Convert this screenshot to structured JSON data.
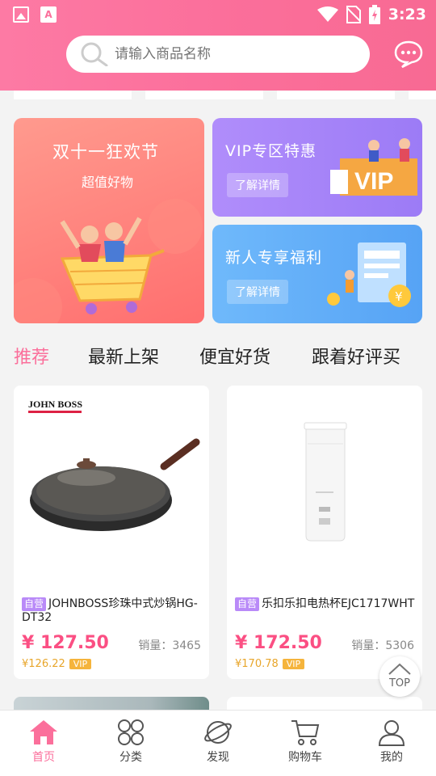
{
  "status_bar": {
    "time": "3:23"
  },
  "search": {
    "placeholder": "请输入商品名称"
  },
  "banners": {
    "main": {
      "title": "双十一狂欢节",
      "subtitle": "超值好物"
    },
    "vip": {
      "title": "VIP专区特惠",
      "button": "了解详情",
      "badge": "VIP"
    },
    "new": {
      "title": "新人专享福利",
      "button": "了解详情"
    }
  },
  "tabs": [
    "推荐",
    "最新上架",
    "便宜好货",
    "跟着好评买"
  ],
  "products": [
    {
      "brand": "JOHN BOSS",
      "tag": "自营",
      "name": "JOHNBOSS珍珠中式炒锅HG-DT32",
      "price": "¥ 127.50",
      "sales": "销量：3465",
      "vip_price": "¥126.22",
      "vip_tag": "VIP"
    },
    {
      "brand": "",
      "tag": "自营",
      "name": "乐扣乐扣电热杯EJC1717WHT",
      "price": "¥ 172.50",
      "sales": "销量：5306",
      "vip_price": "¥170.78",
      "vip_tag": "VIP"
    }
  ],
  "top_button": "TOP",
  "nav": [
    "首页",
    "分类",
    "发现",
    "购物车",
    "我的"
  ],
  "colors": {
    "accent": "#fb6f9b",
    "price": "#fb4f83",
    "vip": "#f5b43c"
  }
}
